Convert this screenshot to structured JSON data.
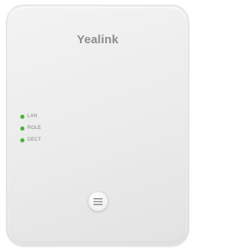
{
  "device": {
    "brand": "Yealink",
    "indicators": [
      {
        "label": "LAN",
        "color": "#4caf3a"
      },
      {
        "label": "ROLE",
        "color": "#4caf3a"
      },
      {
        "label": "DECT",
        "color": "#4caf3a"
      }
    ],
    "button_icon": "menu-icon"
  }
}
